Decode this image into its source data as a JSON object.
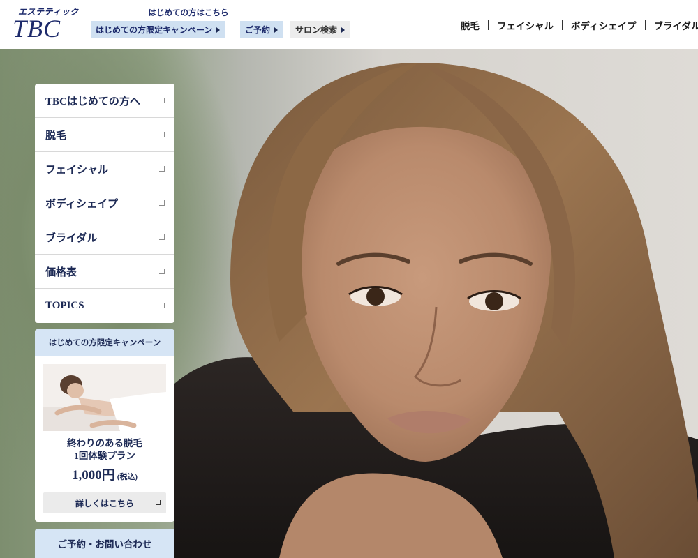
{
  "header": {
    "logo_sub": "エステティック",
    "logo_main": "TBC",
    "first_time_text": "はじめての方はこちら",
    "buttons": [
      {
        "label": "はじめての方限定キャンペーン"
      },
      {
        "label": "ご予約"
      },
      {
        "label": "サロン検索"
      }
    ],
    "nav": [
      {
        "label": "脱毛"
      },
      {
        "label": "フェイシャル"
      },
      {
        "label": "ボディシェイプ"
      },
      {
        "label": "ブライダル"
      }
    ]
  },
  "sidemenu": {
    "items": [
      {
        "label": "TBCはじめての方へ"
      },
      {
        "label": "脱毛"
      },
      {
        "label": "フェイシャル"
      },
      {
        "label": "ボディシェイプ"
      },
      {
        "label": "ブライダル"
      },
      {
        "label": "価格表"
      },
      {
        "label": "TOPICS"
      }
    ]
  },
  "campaign": {
    "heading": "はじめての方限定キャンペーン",
    "line1": "終わりのある脱毛",
    "line2": "1回体験プラン",
    "price": "1,000円",
    "tax": "(税込)",
    "button_label": "詳しくはこちら"
  },
  "contact": {
    "label": "ご予約・お問い合わせ"
  },
  "colors": {
    "brand_navy": "#1d2a6b",
    "accent_blue": "#cfe0f1",
    "header_bg": "#ffffff"
  }
}
